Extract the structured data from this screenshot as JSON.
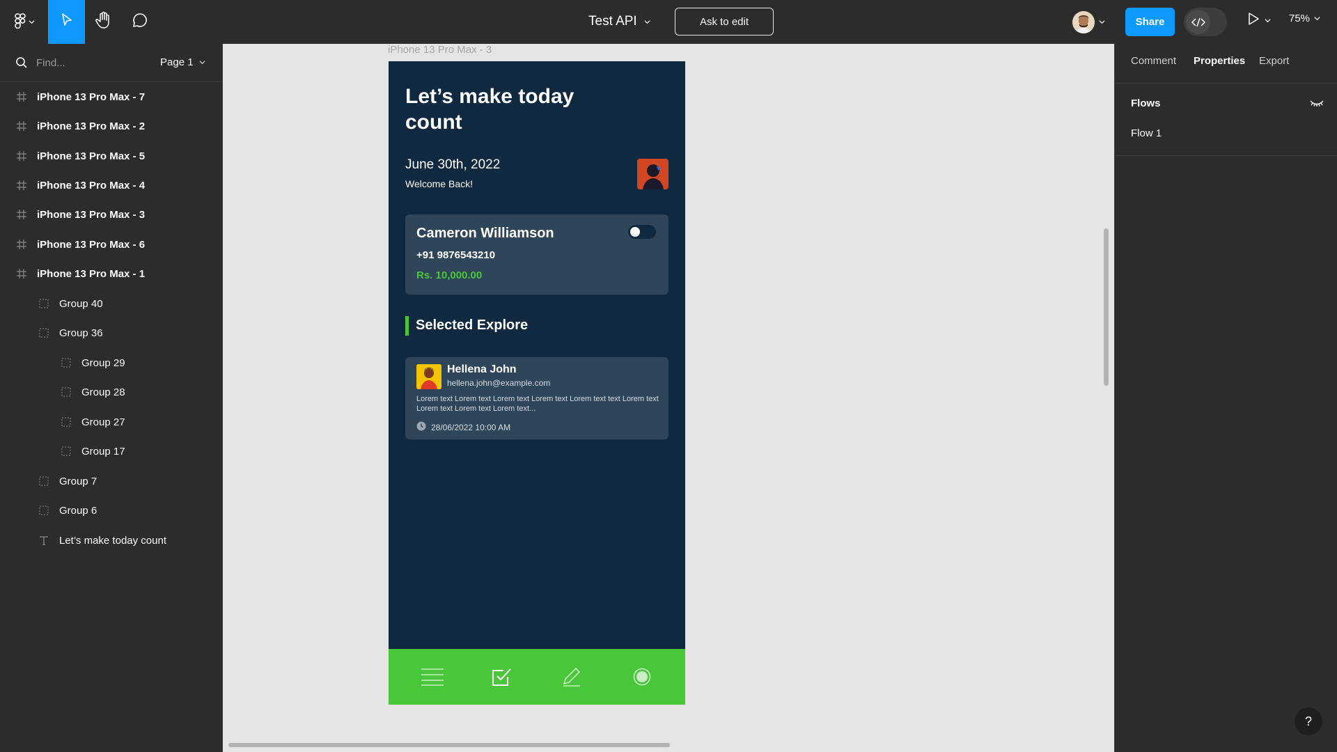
{
  "toolbar": {
    "file_title": "Test API",
    "ask_to_edit": "Ask to edit",
    "share": "Share",
    "zoom": "75%"
  },
  "left_panel": {
    "search_placeholder": "Find...",
    "page": "Page 1",
    "layers": [
      {
        "label": "iPhone 13 Pro Max - 7",
        "kind": "frame"
      },
      {
        "label": "iPhone 13 Pro Max - 2",
        "kind": "frame"
      },
      {
        "label": "iPhone 13 Pro Max - 5",
        "kind": "frame"
      },
      {
        "label": "iPhone 13 Pro Max - 4",
        "kind": "frame"
      },
      {
        "label": "iPhone 13 Pro Max - 3",
        "kind": "frame"
      },
      {
        "label": "iPhone 13 Pro Max - 6",
        "kind": "frame"
      },
      {
        "label": "iPhone 13 Pro Max - 1",
        "kind": "frame"
      },
      {
        "label": "Group 40",
        "kind": "group"
      },
      {
        "label": "Group 36",
        "kind": "group"
      },
      {
        "label": "Group 29",
        "kind": "group"
      },
      {
        "label": "Group 28",
        "kind": "group"
      },
      {
        "label": "Group 27",
        "kind": "group"
      },
      {
        "label": "Group 17",
        "kind": "group"
      },
      {
        "label": "Group 7",
        "kind": "group"
      },
      {
        "label": "Group 6",
        "kind": "group"
      },
      {
        "label": "Let’s make today count",
        "kind": "text"
      }
    ]
  },
  "canvas": {
    "frame_label": "iPhone 13 Pro Max - 3",
    "phone": {
      "heading": "Let’s make today count",
      "date": "June 30th, 2022",
      "welcome": "Welcome Back!",
      "account": {
        "name": "Cameron Williamson",
        "phone": "+91 9876543210",
        "amount": "Rs. 10,000.00"
      },
      "section_title": "Selected Explore",
      "explore_card": {
        "name": "Hellena John",
        "email": "hellena.john@example.com",
        "body": "Lorem text Lorem text Lorem text Lorem text Lorem text text Lorem text Lorem text Lorem text Lorem text...",
        "datetime": "28/06/2022 10:00 AM"
      },
      "nav_icons": [
        "menu-icon",
        "checkbox-icon",
        "pencil-icon",
        "radio-icon"
      ]
    }
  },
  "right_panel": {
    "tabs": [
      "Comment",
      "Properties",
      "Export"
    ],
    "active_tab": "Properties",
    "flows_title": "Flows",
    "flows": [
      "Flow 1"
    ]
  },
  "colors": {
    "accent_blue": "#0d99ff",
    "phone_bg": "#0f2940",
    "card_bg": "#2f4559",
    "green": "#4ac63a",
    "panel_bg": "#2c2c2c"
  }
}
